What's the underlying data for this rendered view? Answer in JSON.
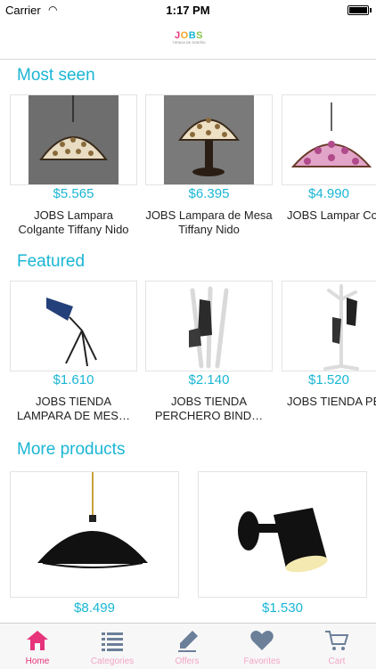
{
  "status": {
    "carrier": "Carrier",
    "time": "1:17 PM"
  },
  "header": {
    "logo_text": "JOBS",
    "logo_sub": "TIENDA DE DISEÑO"
  },
  "sections": {
    "most_seen": {
      "title": "Most seen",
      "items": [
        {
          "price": "$5.565",
          "name": "JOBS Lampara Colgante Tiffany Nido"
        },
        {
          "price": "$6.395",
          "name": "JOBS Lampara de Mesa Tiffany Nido"
        },
        {
          "price": "$4.990",
          "name": "JOBS Lampar Colgante Tiffany"
        }
      ]
    },
    "featured": {
      "title": "Featured",
      "items": [
        {
          "price": "$1.610",
          "name": "JOBS TIENDA LAMPARA DE MES…"
        },
        {
          "price": "$2.140",
          "name": "JOBS TIENDA PERCHERO BIND…"
        },
        {
          "price": "$1.520",
          "name": "JOBS TIENDA PERCHERO SOL"
        }
      ]
    },
    "more_products": {
      "title": "More products",
      "items": [
        {
          "price": "$8.499"
        },
        {
          "price": "$1.530"
        }
      ]
    }
  },
  "tabs": [
    {
      "label": "Home",
      "icon": "home-icon",
      "active": true
    },
    {
      "label": "Categories",
      "icon": "list-icon",
      "active": false
    },
    {
      "label": "Offers",
      "icon": "tag-icon",
      "active": false
    },
    {
      "label": "Favorites",
      "icon": "heart-icon",
      "active": false
    },
    {
      "label": "Cart",
      "icon": "cart-icon",
      "active": false
    }
  ],
  "colors": {
    "accent": "#1ab6d4",
    "tab_active": "#e6337a",
    "tab_inactive": "#f2a6c6",
    "tab_icon_inactive": "#6b7f99"
  }
}
